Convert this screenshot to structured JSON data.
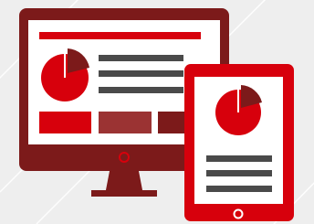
{
  "illustration": {
    "background_color": "#eeeeee",
    "line_color": "#ffffff",
    "monitor": {
      "frame_color": "#7c1a1a",
      "screen_color": "#ffffff",
      "header_bar_color": "#d7000c",
      "pie_colors": [
        "#d7000c",
        "#7c1a1a"
      ],
      "text_line_color": "#4a4a4a",
      "block_colors": [
        "#d7000c",
        "#9b3333",
        "#7c1a1a"
      ],
      "power_button_color": "#d7000c",
      "stand_color": "#7c1a1a"
    },
    "tablet": {
      "frame_color": "#d7000c",
      "screen_color": "#ffffff",
      "pie_colors": [
        "#d7000c",
        "#7c1a1a"
      ],
      "text_line_color": "#4a4a4a",
      "home_button_color": "#ffffff"
    }
  }
}
